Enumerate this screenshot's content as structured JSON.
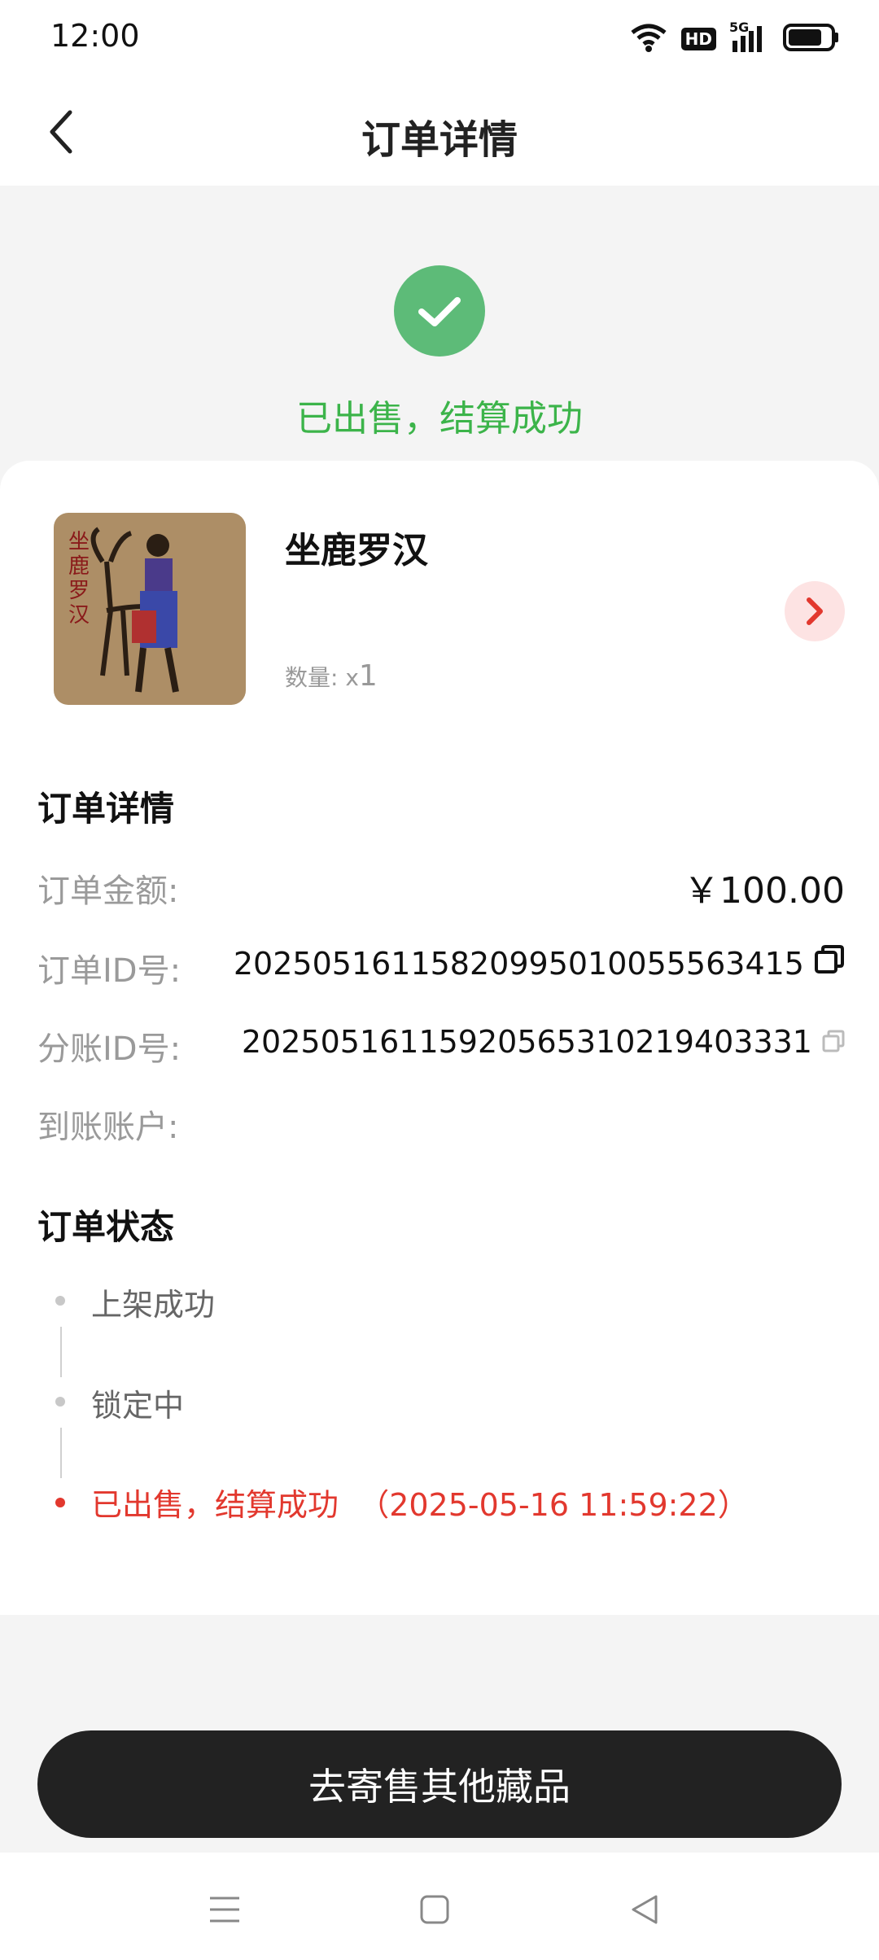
{
  "status_bar": {
    "time": "12:00",
    "hd_label": "HD",
    "network_label": "5G"
  },
  "header": {
    "title": "订单详情"
  },
  "status_hero": {
    "text": "已出售，结算成功",
    "color": "#3cb44a"
  },
  "product": {
    "name": "坐鹿罗汉",
    "quantity_label": "数量:",
    "quantity_prefix": "x",
    "quantity_value": "1",
    "image_caption": "坐鹿罗汉"
  },
  "order_details": {
    "title": "订单详情",
    "rows": [
      {
        "label": "订单金额:",
        "value": "￥100.00"
      },
      {
        "label": "订单ID号:",
        "value": "20250516115820995010055563415"
      },
      {
        "label": "分账ID号:",
        "value": "20250516115920565310219403331"
      },
      {
        "label": "到账账户:",
        "value": ""
      }
    ]
  },
  "order_status": {
    "title": "订单状态",
    "steps": [
      {
        "text": "上架成功"
      },
      {
        "text": "锁定中"
      },
      {
        "text": "已出售，结算成功",
        "time": "（2025-05-16 11:59:22）",
        "color": "#e2382e"
      }
    ]
  },
  "cta": {
    "label": "去寄售其他藏品"
  },
  "icons": [
    "wifi-icon",
    "hd-icon",
    "signal-icon",
    "battery-icon",
    "back-arrow-icon",
    "check-icon",
    "chevron-right-icon",
    "copy-icon",
    "menu-icon",
    "home-icon",
    "back-triangle-icon"
  ]
}
